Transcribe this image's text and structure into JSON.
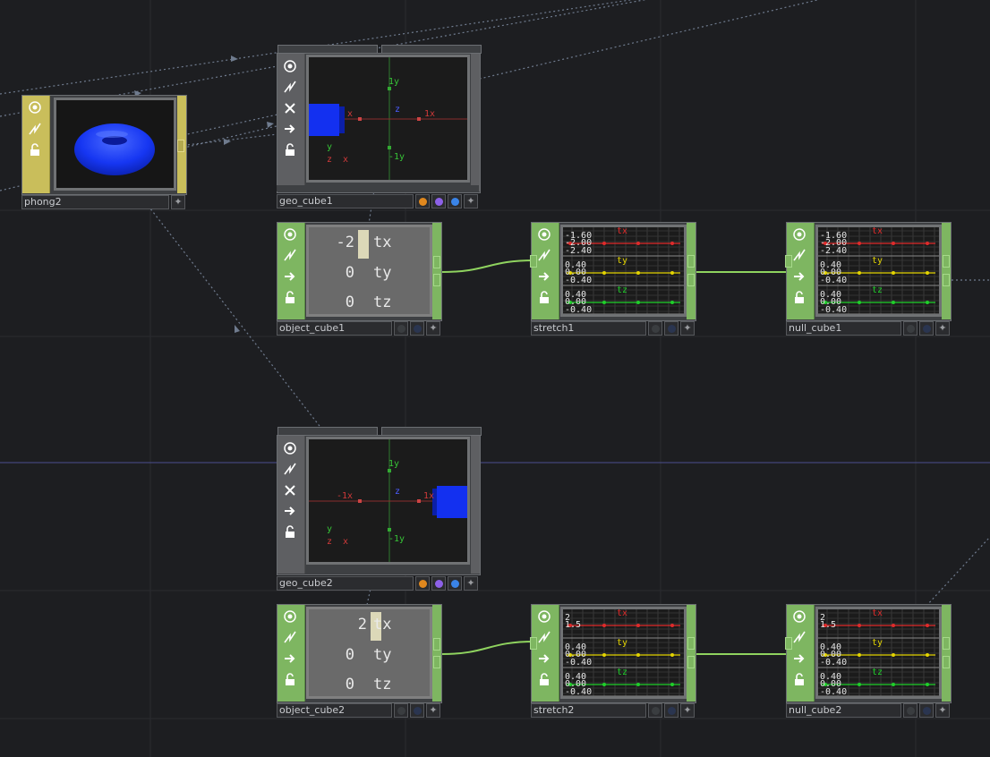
{
  "canvas": {
    "background": "#1d1e21",
    "grid_color": "#2a2c30"
  },
  "nodes": {
    "phong2": {
      "name": "phong2",
      "type": "mat"
    },
    "geo_cube1": {
      "name": "geo_cube1",
      "axis_labels": {
        "y_pos": "1y",
        "y_neg": "-1y",
        "x_neg": "x",
        "x_pos": "1x",
        "z": "z",
        "gizmo_y": "y",
        "gizmo_zx": "z  x"
      }
    },
    "geo_cube2": {
      "name": "geo_cube2",
      "axis_labels": {
        "y_pos": "1y",
        "y_neg": "-1y",
        "x_neg": "-1x",
        "x_pos": "1x",
        "z": "z",
        "gizmo_y": "y",
        "gizmo_zx": "z  x"
      }
    },
    "object_cube1": {
      "name": "object_cube1",
      "rows": [
        {
          "value": "-2",
          "channel": "tx"
        },
        {
          "value": "0",
          "channel": "ty"
        },
        {
          "value": "0",
          "channel": "tz"
        }
      ]
    },
    "object_cube2": {
      "name": "object_cube2",
      "rows": [
        {
          "value": "2",
          "channel": "tx"
        },
        {
          "value": "0",
          "channel": "ty"
        },
        {
          "value": "0",
          "channel": "tz"
        }
      ]
    },
    "stretch1": {
      "name": "stretch1",
      "channels": [
        {
          "name": "tx",
          "color": "#e02b2b",
          "labels": [
            "-1.60",
            "-2.00",
            "-2.40"
          ]
        },
        {
          "name": "ty",
          "color": "#e3d400",
          "labels": [
            "0.40",
            "0.00",
            "-0.40"
          ]
        },
        {
          "name": "tz",
          "color": "#1fcf2a",
          "labels": [
            "0.40",
            "0.00",
            "-0.40"
          ]
        }
      ]
    },
    "null_cube1": {
      "name": "null_cube1",
      "channels": [
        {
          "name": "tx",
          "color": "#e02b2b",
          "labels": [
            "-1.60",
            "-2.00",
            "-2.40"
          ]
        },
        {
          "name": "ty",
          "color": "#e3d400",
          "labels": [
            "0.40",
            "0.00",
            "-0.40"
          ]
        },
        {
          "name": "tz",
          "color": "#1fcf2a",
          "labels": [
            "0.40",
            "0.00",
            "-0.40"
          ]
        }
      ]
    },
    "stretch2": {
      "name": "stretch2",
      "channels": [
        {
          "name": "tx",
          "color": "#e02b2b",
          "labels": [
            "2",
            "1.5"
          ]
        },
        {
          "name": "ty",
          "color": "#e3d400",
          "labels": [
            "0.40",
            "0.00",
            "-0.40"
          ]
        },
        {
          "name": "tz",
          "color": "#1fcf2a",
          "labels": [
            "0.40",
            "0.00",
            "-0.40"
          ]
        }
      ]
    },
    "null_cube2": {
      "name": "null_cube2",
      "channels": [
        {
          "name": "tx",
          "color": "#e02b2b",
          "labels": [
            "2",
            "1.5"
          ]
        },
        {
          "name": "ty",
          "color": "#e3d400",
          "labels": [
            "0.40",
            "0.00",
            "-0.40"
          ]
        },
        {
          "name": "tz",
          "color": "#1fcf2a",
          "labels": [
            "0.40",
            "0.00",
            "-0.40"
          ]
        }
      ]
    }
  },
  "icons": {
    "strip_buttons": [
      "viewer-toggle-icon",
      "bypass-icon",
      "lock-x-icon",
      "display-arrow-icon",
      "cook-lock-icon"
    ]
  },
  "flag_colors": {
    "render": "#e0881e",
    "display": "#8d61e8",
    "pick": "#3a84e8",
    "off": "#3a3d40"
  }
}
